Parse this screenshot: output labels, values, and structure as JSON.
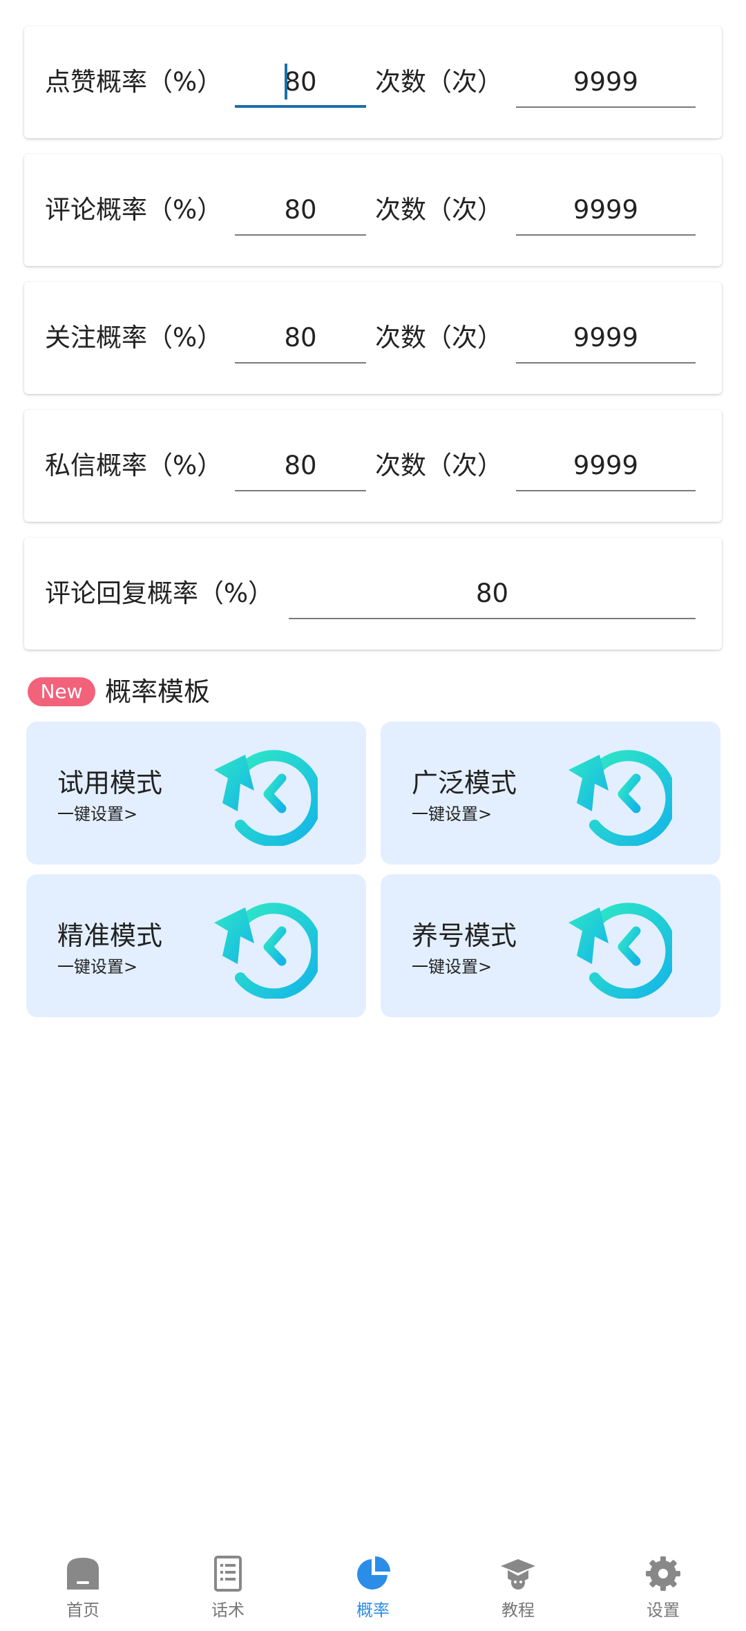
{
  "settings": [
    {
      "label": "点赞概率（%）",
      "prob": "80",
      "count_label": "次数（次）",
      "count": "9999"
    },
    {
      "label": "评论概率（%）",
      "prob": "80",
      "count_label": "次数（次）",
      "count": "9999"
    },
    {
      "label": "关注概率（%）",
      "prob": "80",
      "count_label": "次数（次）",
      "count": "9999"
    },
    {
      "label": "私信概率（%）",
      "prob": "80",
      "count_label": "次数（次）",
      "count": "9999"
    }
  ],
  "reply": {
    "label": "评论回复概率（%）",
    "value": "80"
  },
  "templates": {
    "badge": "New",
    "title": "概率模板",
    "items": [
      {
        "name": "试用模式",
        "action": "一键设置>"
      },
      {
        "name": "广泛模式",
        "action": "一键设置>"
      },
      {
        "name": "精准模式",
        "action": "一键设置>"
      },
      {
        "name": "养号模式",
        "action": "一键设置>"
      }
    ]
  },
  "nav": [
    {
      "label": "首页",
      "icon": "home-icon"
    },
    {
      "label": "话术",
      "icon": "script-document-icon"
    },
    {
      "label": "概率",
      "icon": "pie-chart-icon",
      "active": true
    },
    {
      "label": "教程",
      "icon": "graduation-cap-icon"
    },
    {
      "label": "设置",
      "icon": "gear-icon"
    }
  ],
  "colors": {
    "accent": "#2b8de8",
    "badge": "#f2627a",
    "card_bg": "#e3efff",
    "icon_gradient_start": "#2ee6c5",
    "icon_gradient_end": "#14b5e8",
    "focus_underline": "#1e6fa6"
  }
}
